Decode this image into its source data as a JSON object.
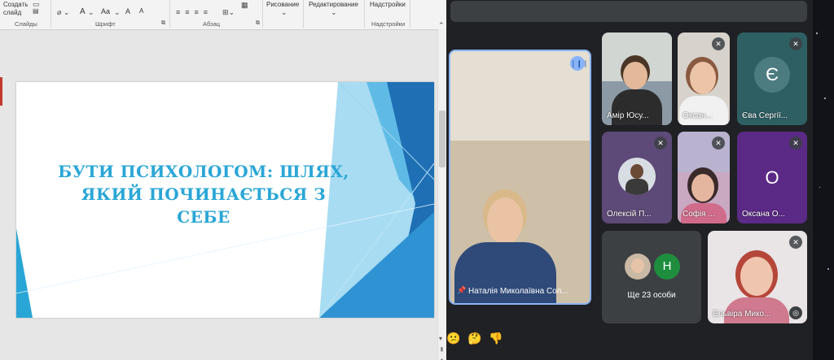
{
  "ribbon": {
    "create_slide": "Создать\nслайд",
    "create_slide_line1": "Создать",
    "create_slide_line2": "слайд",
    "groups": [
      "Слайды",
      "Шрифт",
      "Абзац",
      "Надстройки"
    ],
    "drawing": "Рисование",
    "editing": "Редактирование",
    "addins": "Надстройки",
    "font_btn_a": "A",
    "font_btn_aa": "Aa"
  },
  "slide": {
    "title_line1": "БУТИ ПСИХОЛОГОМ: ШЛЯХ,",
    "title_line2": "ЯКИЙ ПОЧИНАЄТЬСЯ З СЕБЕ"
  },
  "meet": {
    "presenter_name": "Наталія Миколаївна Сол...",
    "tiles": [
      {
        "name": "Амір Юсу..."
      },
      {
        "name": "Оксан..."
      },
      {
        "name": "Єва Сергії...",
        "initial": "Є"
      },
      {
        "name": "Олексій П..."
      },
      {
        "name": "Софія ..."
      },
      {
        "name": "Оксана О...",
        "initial": "О"
      },
      {
        "name": "Ще 23 особи",
        "initial": "Н"
      },
      {
        "name": "Ельвіра Мико..."
      }
    ],
    "colors": {
      "bg": "#202124",
      "tile": "#3c4043",
      "eva_tile": "#2e5f63",
      "oksana_tile": "#5b2a86",
      "green_avatar": "#1e8e3e",
      "speaking_border": "#8ab4f8"
    }
  },
  "colors": {
    "title_blue": "#2aa6d6",
    "slide_blue_dark": "#1f6fb5",
    "slide_blue_light": "#a8dcf2"
  }
}
